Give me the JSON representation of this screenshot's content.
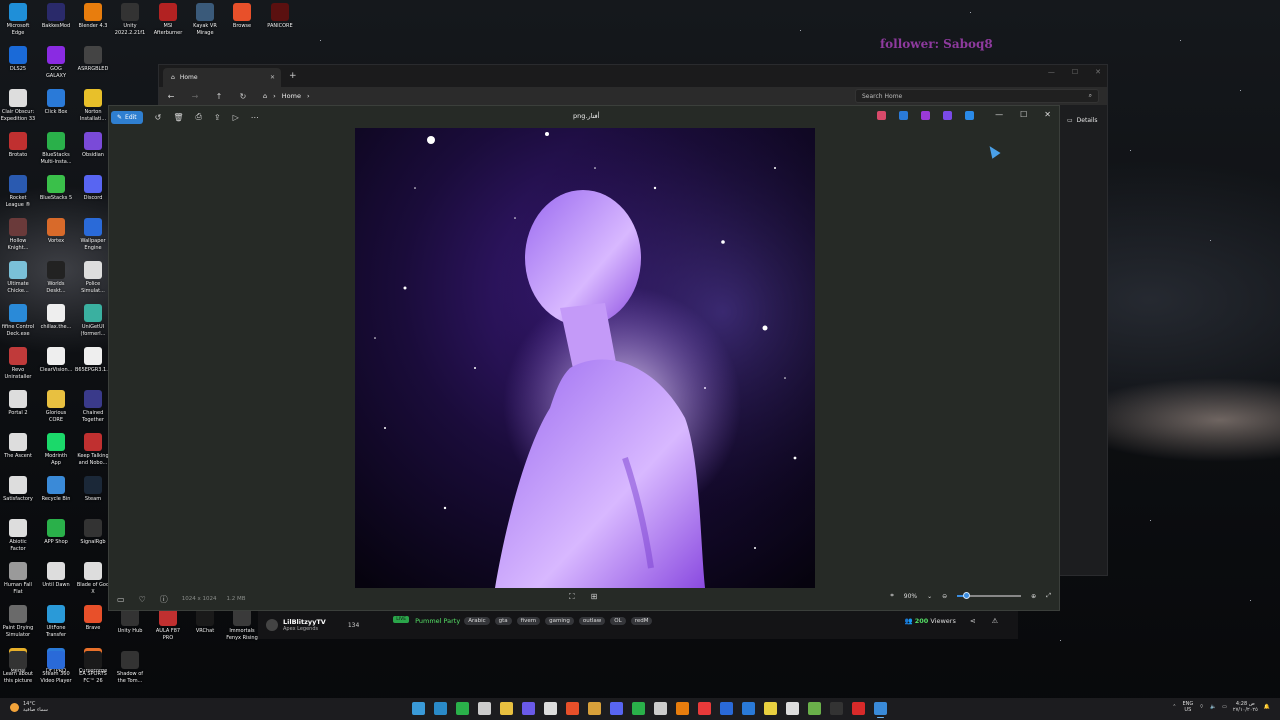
{
  "overlay": {
    "follower_text": "follower: Saboq8"
  },
  "desktop_icons": [
    {
      "label": "Microsoft\nEdge",
      "color": "#1f8fd8",
      "icon": "edge-icon"
    },
    {
      "label": "BakkesMod",
      "color": "#2a2a6a",
      "icon": "bakkesmod-icon"
    },
    {
      "label": "Blender 4.3",
      "color": "#e87d0d",
      "icon": "blender-icon"
    },
    {
      "label": "Unity\n2022.2.21f1",
      "color": "#333333",
      "icon": "unity-icon"
    },
    {
      "label": "MSI\nAfterburner",
      "color": "#b22222",
      "icon": "msi-afterburner-icon"
    },
    {
      "label": "Kayak VR\nMirage",
      "color": "#3a5a7a",
      "icon": "kayak-vr-icon"
    },
    {
      "label": "Browse",
      "color": "#e8502a",
      "icon": "brave-icon"
    },
    {
      "label": "PANICORE",
      "color": "#5a1010",
      "icon": "panicore-icon"
    },
    {
      "label": "DLS25",
      "color": "#1a6ad8",
      "icon": "dls25-icon"
    },
    {
      "label": "GOG\nGALAXY",
      "color": "#8a2be2",
      "icon": "gog-galaxy-icon"
    },
    {
      "label": "ASRRGBLED",
      "color": "#444444",
      "icon": "asrrgbled-icon"
    },
    {
      "label": "Clair Obscur:\nExpedition 33",
      "color": "#dddddd",
      "icon": "clair-obscur-icon"
    },
    {
      "label": "Click Box",
      "color": "#2a7ad8",
      "icon": "click-box-icon"
    },
    {
      "label": "Norton\nInstallati...",
      "color": "#e8c02a",
      "icon": "norton-icon"
    },
    {
      "label": "Brotato",
      "color": "#c03030",
      "icon": "brotato-icon"
    },
    {
      "label": "BlueStacks\nMulti-Insta...",
      "color": "#2ab04a",
      "icon": "bluestacks-multi-icon"
    },
    {
      "label": "Obsidian",
      "color": "#7a4ad8",
      "icon": "obsidian-icon"
    },
    {
      "label": "Rocket\nLeague ®",
      "color": "#2a5ab0",
      "icon": "rocket-league-icon"
    },
    {
      "label": "BlueStacks 5",
      "color": "#3ac04a",
      "icon": "bluestacks-icon"
    },
    {
      "label": "Discord",
      "color": "#5865f2",
      "icon": "discord-icon"
    },
    {
      "label": "Hollow\nKnight...",
      "color": "#6a3a3a",
      "icon": "hollow-knight-icon"
    },
    {
      "label": "Vortex",
      "color": "#d86a2a",
      "icon": "vortex-icon"
    },
    {
      "label": "Wallpaper\nEngine",
      "color": "#2a6ad8",
      "icon": "wallpaper-engine-icon"
    },
    {
      "label": "Ultimate\nChicke...",
      "color": "#7ac0d8",
      "icon": "ultimate-chicken-icon"
    },
    {
      "label": "Worlds\nDeskt...",
      "color": "#222222",
      "icon": "worlds-desktop-icon"
    },
    {
      "label": "Police\nSimulat...",
      "color": "#dddddd",
      "icon": "police-sim-icon"
    },
    {
      "label": "fifine Control\nDeck.exe",
      "color": "#2a8ad8",
      "icon": "fifine-icon"
    },
    {
      "label": "chillax.the...",
      "color": "#eeeeee",
      "icon": "file-icon"
    },
    {
      "label": "UniGetUI\n(formerl...",
      "color": "#3ab0a0",
      "icon": "unigetui-icon"
    },
    {
      "label": "Revo\nUninstaller",
      "color": "#c03a3a",
      "icon": "revo-icon"
    },
    {
      "label": "ClearVision...",
      "color": "#eeeeee",
      "icon": "file-icon"
    },
    {
      "label": "B65EPGR3.1...",
      "color": "#eeeeee",
      "icon": "file-icon"
    },
    {
      "label": "Portal 2",
      "color": "#dddddd",
      "icon": "portal2-icon"
    },
    {
      "label": "Glorious\nCORE",
      "color": "#e8c040",
      "icon": "glorious-core-icon"
    },
    {
      "label": "Chained\nTogether",
      "color": "#3a3a8a",
      "icon": "chained-together-icon"
    },
    {
      "label": "The Ascent",
      "color": "#dddddd",
      "icon": "the-ascent-icon"
    },
    {
      "label": "Modrinth\nApp",
      "color": "#1bd96a",
      "icon": "modrinth-icon"
    },
    {
      "label": "Keep Talking\nand Nobo...",
      "color": "#c03030",
      "icon": "keep-talking-icon"
    },
    {
      "label": "Satisfactory",
      "color": "#dddddd",
      "icon": "satisfactory-icon"
    },
    {
      "label": "Recycle Bin",
      "color": "#3a8ad8",
      "icon": "recycle-bin-icon"
    },
    {
      "label": "Steam",
      "color": "#1b2838",
      "icon": "steam-icon"
    },
    {
      "label": "Abiotic\nFactor",
      "color": "#dddddd",
      "icon": "abiotic-factor-icon"
    },
    {
      "label": "APP Shop",
      "color": "#2ab04a",
      "icon": "app-shop-icon"
    },
    {
      "label": "SignalRgb",
      "color": "#333333",
      "icon": "signalrgb-icon"
    },
    {
      "label": "Human Fall\nFlat",
      "color": "#9a9a9a",
      "icon": "human-fall-flat-icon"
    },
    {
      "label": "Until Dawn",
      "color": "#dddddd",
      "icon": "until-dawn-icon"
    },
    {
      "label": "Blade of God\nX",
      "color": "#dddddd",
      "icon": "blade-of-god-icon"
    },
    {
      "label": "Paint Drying\nSimulator",
      "color": "#6a6a6a",
      "icon": "paint-drying-icon"
    },
    {
      "label": "UltFone\nTransfer",
      "color": "#2a9ad8",
      "icon": "ultfone-icon"
    },
    {
      "label": "Brave",
      "color": "#e8502a",
      "icon": "brave-icon"
    },
    {
      "label": "Medal",
      "color": "#e8b02a",
      "icon": "medal-icon"
    },
    {
      "label": "DFTPRO",
      "color": "#2a7ad8",
      "icon": "dftpro-icon"
    },
    {
      "label": "CurseForge",
      "color": "#e8702a",
      "icon": "curseforge-icon"
    },
    {
      "label": "Unity Hub",
      "color": "#333333",
      "icon": "unity-hub-icon"
    },
    {
      "label": "AULA F87\nPRO",
      "color": "#c03030",
      "icon": "aula-icon"
    },
    {
      "label": "VRChat",
      "color": "#1a1a1a",
      "icon": "vrchat-icon"
    },
    {
      "label": "Immortals\nFenyx Rising",
      "color": "#3a3a3a",
      "icon": "immortals-icon"
    },
    {
      "label": "Learn about\nthis picture",
      "color": "#333333",
      "icon": "learn-picture-icon"
    },
    {
      "label": "Steam 360\nVideo Player",
      "color": "#2a6ad8",
      "icon": "steam-360-icon"
    },
    {
      "label": "EA SPORTS\nFC™ 26",
      "color": "#1a1a1a",
      "icon": "ea-sports-icon"
    },
    {
      "label": "Shadow of\nthe Tom...",
      "color": "#333333",
      "icon": "shadow-tomb-raider-icon"
    }
  ],
  "explorer": {
    "tab_label": "Home",
    "breadcrumb": "Home",
    "search_placeholder": "Search Home",
    "details_label": "Details"
  },
  "viewer": {
    "edit_label": "Edit",
    "file_title": "png.أفتار",
    "dimensions": "1024 x 1024",
    "file_size": "1.2 MB",
    "zoom_label": "90%",
    "zoom_fraction": 0.14
  },
  "stream": {
    "channel": "LilBlitzyyTV",
    "game": "Apex Legends",
    "count": "134",
    "live": "LIVE",
    "title": "Pummel Party",
    "tags": [
      "Arabic",
      "gta",
      "fivem",
      "gaming",
      "outlaw",
      "OL",
      "redM"
    ],
    "viewers_count": "200",
    "viewers_label": "Viewers"
  },
  "taskbar": {
    "temperature": "14°C",
    "weather_text": "سماء صافية",
    "lang_top": "ENG",
    "lang_bottom": "US",
    "time": "4:28 ص",
    "date": "٢٧/١٠/٢٠٢٥",
    "apps": [
      {
        "icon": "windows-start-icon",
        "color": "#3a9ad8"
      },
      {
        "icon": "widgets-icon",
        "color": "#2a8ac8"
      },
      {
        "icon": "xbox-icon",
        "color": "#2ab04a"
      },
      {
        "icon": "git-icon",
        "color": "#cccccc"
      },
      {
        "icon": "file-explorer-icon",
        "color": "#e8c040"
      },
      {
        "icon": "copilot-icon",
        "color": "#6a5ae8"
      },
      {
        "icon": "calendar-icon",
        "color": "#dddddd"
      },
      {
        "icon": "brave-icon",
        "color": "#e8502a"
      },
      {
        "icon": "package-icon",
        "color": "#d8a03a"
      },
      {
        "icon": "discord-icon",
        "color": "#5865f2"
      },
      {
        "icon": "puzzle-icon",
        "color": "#2ab04a"
      },
      {
        "icon": "github-icon",
        "color": "#cccccc"
      },
      {
        "icon": "blender-icon",
        "color": "#e87d0d"
      },
      {
        "icon": "vivaldi-icon",
        "color": "#e83a3a"
      },
      {
        "icon": "bitwarden-icon",
        "color": "#2a6ad8"
      },
      {
        "icon": "vscode-icon",
        "color": "#2a7ad8"
      },
      {
        "icon": "sticky-notes-icon",
        "color": "#e8d040"
      },
      {
        "icon": "feather-icon",
        "color": "#dddddd"
      },
      {
        "icon": "minecraft-icon",
        "color": "#6ab04a"
      },
      {
        "icon": "terminal-icon",
        "color": "#333333"
      },
      {
        "icon": "acrobat-icon",
        "color": "#d82a2a"
      },
      {
        "icon": "photos-icon",
        "color": "#3a8ad8"
      }
    ]
  }
}
